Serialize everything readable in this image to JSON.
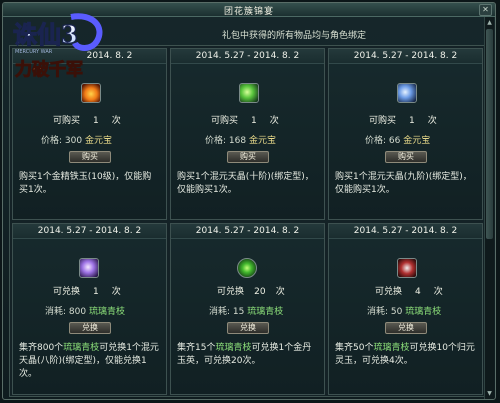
{
  "window": {
    "title": "团花簇锦宴",
    "close_label": "✕"
  },
  "logo": {
    "line1": "诛仙3",
    "line2": "力破千军",
    "caption": "MERCURY WAR"
  },
  "notice": "礼包中获得的所有物品均与角色绑定",
  "cards": [
    {
      "date": "2014. 8. 2",
      "qty_label": "可购买",
      "qty_value": "1",
      "qty_unit": "次",
      "price_label": "价格:",
      "price_value": "300",
      "price_unit": "金元宝",
      "button": "购买",
      "desc": "购买1个金精铁玉(10级)，仅能购买1次。",
      "icon": "fire-orb-icon"
    },
    {
      "date": "2014. 5.27 - 2014. 8. 2",
      "qty_label": "可购买",
      "qty_value": "1",
      "qty_unit": "次",
      "price_label": "价格:",
      "price_value": "168",
      "price_unit": "金元宝",
      "button": "购买",
      "desc": "购买1个混元天晶(十阶)(绑定型)，仅能购买1次。",
      "icon": "green-crystal-icon"
    },
    {
      "date": "2014. 5.27 - 2014. 8. 2",
      "qty_label": "可购买",
      "qty_value": "1",
      "qty_unit": "次",
      "price_label": "价格:",
      "price_value": "66",
      "price_unit": "金元宝",
      "button": "购买",
      "desc": "购买1个混元天晶(九阶)(绑定型)，仅能购买1次。",
      "icon": "blue-crystal-icon"
    },
    {
      "date": "2014. 5.27 - 2014. 8. 2",
      "qty_label": "可兑换",
      "qty_value": "1",
      "qty_unit": "次",
      "price_label": "消耗:",
      "price_value": "800",
      "price_unit": "琉璃青枝",
      "button": "兑换",
      "desc_pre": "集齐800个",
      "desc_hl": "琉璃青枝",
      "desc_post": "可兑换1个混元天晶(八阶)(绑定型)，仅能兑换1次。",
      "icon": "purple-crystal-icon"
    },
    {
      "date": "2014. 5.27 - 2014. 8. 2",
      "qty_label": "可兑换",
      "qty_value": "20",
      "qty_unit": "次",
      "price_label": "消耗:",
      "price_value": "15",
      "price_unit": "琉璃青枝",
      "button": "兑换",
      "desc_pre": "集齐15个",
      "desc_hl": "琉璃青枝",
      "desc_post": "可兑换1个金丹玉英，可兑换20次。",
      "icon": "green-pill-icon"
    },
    {
      "date": "2014. 5.27 - 2014. 8. 2",
      "qty_label": "可兑换",
      "qty_value": "4",
      "qty_unit": "次",
      "price_label": "消耗:",
      "price_value": "50",
      "price_unit": "琉璃青枝",
      "button": "兑换",
      "desc_pre": "集齐50个",
      "desc_hl": "琉璃青枝",
      "desc_post": "可兑换10个归元灵玉，可兑换4次。",
      "icon": "red-orb-icon"
    }
  ]
}
